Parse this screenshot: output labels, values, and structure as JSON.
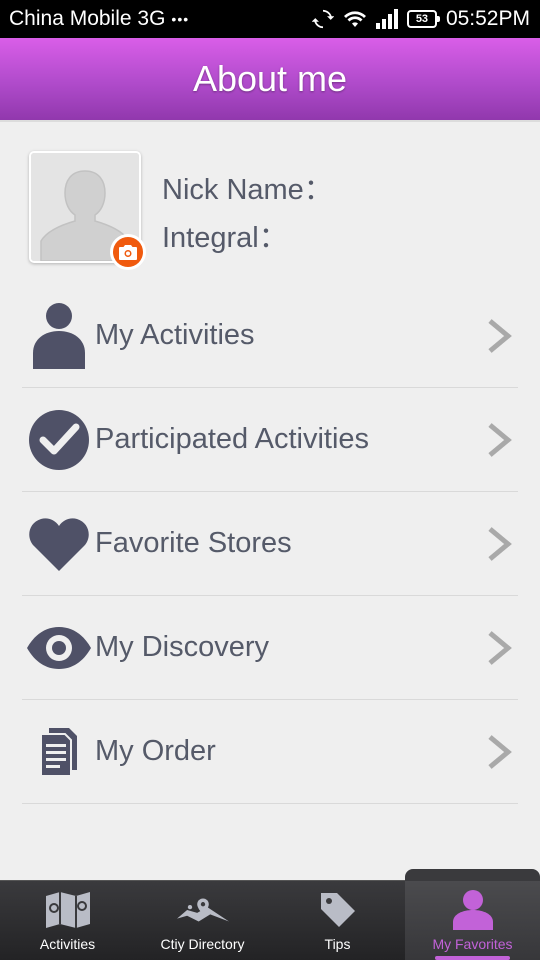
{
  "status": {
    "carrier": "China Mobile 3G",
    "dots": "•••",
    "battery": "53",
    "time": "05:52PM"
  },
  "header": {
    "title": "About me"
  },
  "profile": {
    "nick_label": "Nick Name：",
    "integral_label": "Integral："
  },
  "menu": {
    "items": [
      {
        "label": "My Activities",
        "icon": "person-icon"
      },
      {
        "label": "Participated Activities",
        "icon": "check-circle-icon"
      },
      {
        "label": "Favorite Stores",
        "icon": "heart-icon"
      },
      {
        "label": "My Discovery",
        "icon": "eye-icon"
      },
      {
        "label": "My Order",
        "icon": "document-icon"
      }
    ]
  },
  "tabs": [
    {
      "label": "Activities",
      "icon": "map-icon"
    },
    {
      "label": "Ctiy Directory",
      "icon": "location-pin-icon"
    },
    {
      "label": "Tips",
      "icon": "tag-icon"
    },
    {
      "label": "My Favorites",
      "icon": "user-icon",
      "active": true
    }
  ],
  "colors": {
    "header_purple": "#b04bcb",
    "active_tab": "#c262d8",
    "icon_slate": "#4f5167",
    "camera_orange": "#f05a0e"
  }
}
